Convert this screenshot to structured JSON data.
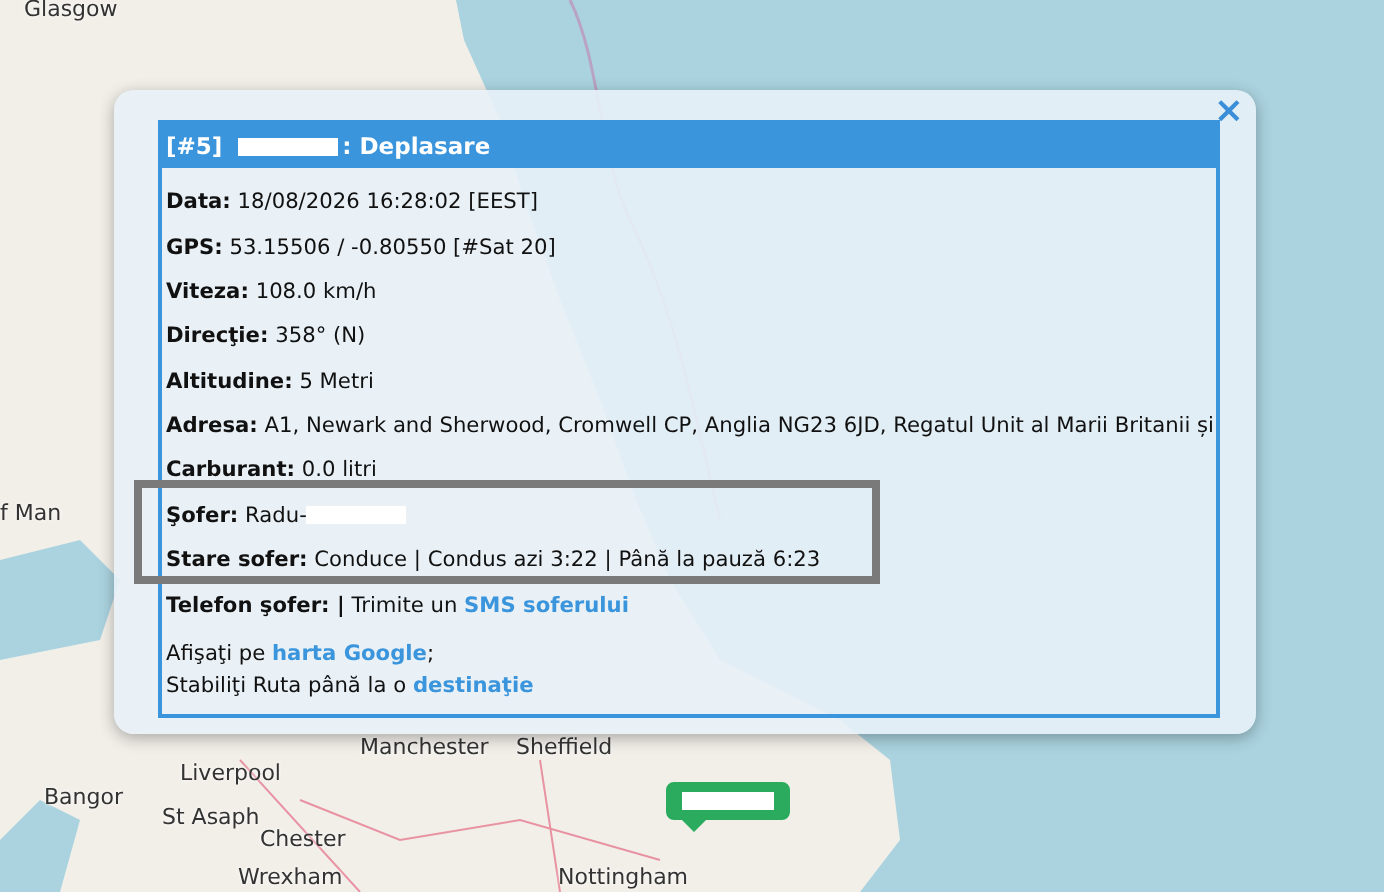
{
  "map": {
    "place_labels": [
      "Glasgow",
      "f Man",
      "Liverpool",
      "Manchester",
      "Sheffield",
      "Bangor",
      "St Asaph",
      "Chester",
      "Wrexham",
      "Nottingham"
    ]
  },
  "popup": {
    "close": "×",
    "header": {
      "index": "[#5]",
      "title": ": Deplasare"
    },
    "fields": [
      {
        "label": "Data:",
        "parts": [
          {
            "kind": "plain",
            "text": "18/08/2026 16:28:02 [EEST]"
          }
        ]
      },
      {
        "label": "GPS:",
        "parts": [
          {
            "kind": "plain",
            "text": "53.15506 / -0.80550 [#Sat 20]"
          }
        ]
      },
      {
        "label": "Viteza:",
        "parts": [
          {
            "kind": "plain",
            "text": "108.0 km/h"
          }
        ]
      },
      {
        "label": "Direcţie:",
        "parts": [
          {
            "kind": "plain",
            "text": "358°  (N)"
          }
        ]
      },
      {
        "label": "Altitudine:",
        "parts": [
          {
            "kind": "plain",
            "text": "5 Metri"
          }
        ]
      },
      {
        "label": "Adresa:",
        "parts": [
          {
            "kind": "plain",
            "text": "A1, Newark and Sherwood, Cromwell CP, Anglia NG23 6JD, Regatul Unit al Marii Britanii și"
          }
        ]
      },
      {
        "label": "Carburant:",
        "parts": [
          {
            "kind": "plain",
            "text": "0.0 litri"
          }
        ]
      },
      {
        "label": "Şofer:",
        "highlighted": true,
        "parts": [
          {
            "kind": "plain",
            "text": "Radu-"
          }
        ]
      },
      {
        "label": "Stare sofer:",
        "highlighted": true,
        "parts": [
          {
            "kind": "plain",
            "text": "Conduce | Condus azi 3:22 | Până la pauză 6:23"
          }
        ]
      },
      {
        "label": "Telefon şofer: |",
        "parts": [
          {
            "kind": "plain",
            "text": "Trimite un"
          },
          {
            "kind": "link",
            "text": "SMS soferului"
          }
        ]
      }
    ],
    "footer": [
      {
        "parts": [
          {
            "kind": "plain",
            "text": "Afişaţi pe"
          },
          {
            "kind": "link",
            "text": "harta Google"
          },
          {
            "kind": "plain",
            "text": ";"
          }
        ]
      },
      {
        "parts": [
          {
            "kind": "plain",
            "text": "Stabiliţi Ruta până la o"
          },
          {
            "kind": "link",
            "text": "destinaţie"
          }
        ]
      }
    ]
  }
}
